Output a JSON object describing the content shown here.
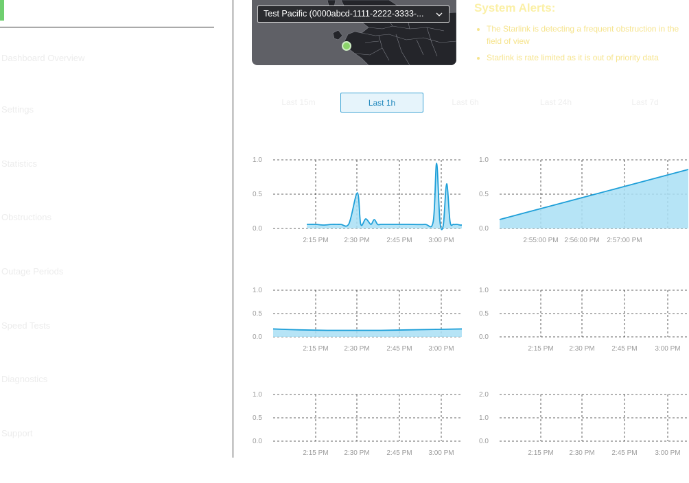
{
  "sidebar": {
    "items": [
      {
        "label": "Dashboard Overview"
      },
      {
        "label": "Settings"
      },
      {
        "label": "Statistics"
      },
      {
        "label": "Obstructions"
      },
      {
        "label": "Outage Periods"
      },
      {
        "label": "Speed Tests"
      },
      {
        "label": "Diagnostics"
      },
      {
        "label": "Support"
      }
    ]
  },
  "device": {
    "selected": "Test Pacific (0000abcd-1111-2222-3333-...",
    "icon": "chevron-down-icon"
  },
  "alerts": {
    "title": "System Alerts:",
    "items": [
      "The Starlink is detecting a frequent obstruction in the field of view",
      "Starlink is rate limited as it is out of priority data"
    ]
  },
  "time_ranges": [
    "Last 15m",
    "Last 1h",
    "Last 6h",
    "Last 24h",
    "Last 7d"
  ],
  "selected_range": "Last 1h",
  "colors": {
    "accent": "#1e9fd8",
    "fill": "#a9dff4",
    "alert": "#f6e48e",
    "status_dot": "#8bd36a"
  },
  "chart_data": [
    {
      "type": "area",
      "x_ticks": [
        "2:15 PM",
        "2:30 PM",
        "2:45 PM",
        "3:00 PM"
      ],
      "y_ticks": [
        0.0,
        0.5,
        1.0
      ],
      "ylim": [
        0,
        1
      ],
      "grid": true,
      "x": [
        2.0,
        2.25,
        2.5,
        2.75,
        3.0,
        3.25,
        3.5,
        3.6,
        3.75,
        3.9,
        4.0,
        4.1,
        4.2,
        4.35,
        4.5,
        5.0,
        5.5,
        5.75,
        5.85,
        5.95,
        6.05,
        6.15,
        6.25,
        6.35,
        6.45,
        6.55,
        6.6
      ],
      "values": [
        0.06,
        0.06,
        0.05,
        0.06,
        0.06,
        0.07,
        0.52,
        0.06,
        0.14,
        0.06,
        0.13,
        0.06,
        0.06,
        0.06,
        0.06,
        0.06,
        0.06,
        0.1,
        0.95,
        0.1,
        0.05,
        0.65,
        0.1,
        0.06,
        0.06,
        0.05,
        0.05
      ],
      "x_units": "quarter-hours from 1:45 PM"
    },
    {
      "type": "area",
      "x_ticks": [
        "2:55:00 PM",
        "2:56:00 PM",
        "2:57:00 PM"
      ],
      "y_ticks": [
        0.0,
        0.5,
        1.0
      ],
      "ylim": [
        0,
        1
      ],
      "grid": true,
      "values": [
        0.13,
        0.86
      ]
    },
    {
      "type": "area",
      "x_ticks": [
        "2:15 PM",
        "2:30 PM",
        "2:45 PM",
        "3:00 PM"
      ],
      "y_ticks": [
        0.0,
        0.5,
        1.0
      ],
      "ylim": [
        0,
        1
      ],
      "grid": true,
      "values": [
        0.17,
        0.15,
        0.14,
        0.14,
        0.14,
        0.15,
        0.16,
        0.17
      ]
    },
    {
      "type": "area",
      "x_ticks": [
        "2:15 PM",
        "2:30 PM",
        "2:45 PM",
        "3:00 PM"
      ],
      "y_ticks": [
        0.0,
        0.5,
        1.0
      ],
      "ylim": [
        0,
        1
      ],
      "grid": true,
      "values": []
    },
    {
      "type": "area",
      "x_ticks": [
        "2:15 PM",
        "2:30 PM",
        "2:45 PM",
        "3:00 PM"
      ],
      "y_ticks": [
        0.0,
        0.5,
        1.0
      ],
      "ylim": [
        0,
        1
      ],
      "grid": true,
      "values": []
    },
    {
      "type": "area",
      "x_ticks": [
        "2:15 PM",
        "2:30 PM",
        "2:45 PM",
        "3:00 PM"
      ],
      "y_ticks": [
        0.0,
        1.0,
        2.0
      ],
      "ylim": [
        0,
        2
      ],
      "grid": true,
      "values": []
    }
  ]
}
